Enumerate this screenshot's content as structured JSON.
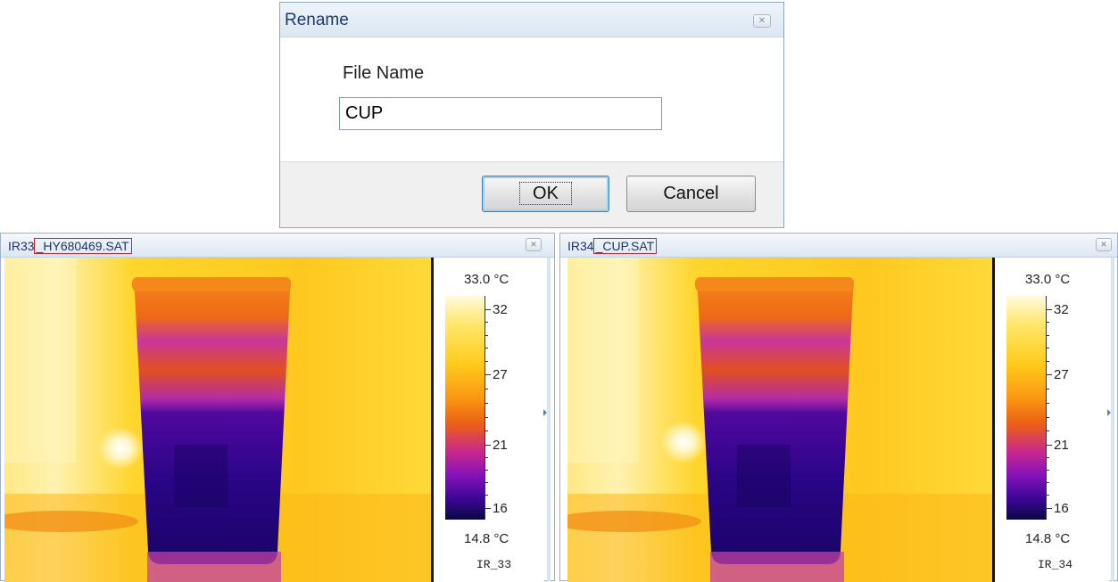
{
  "dialog": {
    "title": "Rename",
    "close_icon": "close-icon",
    "field_label": "File Name",
    "field_value": "CUP",
    "ok_label": "OK",
    "cancel_label": "Cancel"
  },
  "windows": [
    {
      "title_prefix": "IR33",
      "title_highlight": "_HY680469.SAT",
      "scale_max": "33.0 °C",
      "scale_min": "14.8 °C",
      "ticks": [
        "32",
        "27",
        "21",
        "16"
      ],
      "scale_id": "IR_33"
    },
    {
      "title_prefix": "IR34",
      "title_highlight": "_CUP.SAT",
      "scale_max": "33.0 °C",
      "scale_min": "14.8 °C",
      "ticks": [
        "32",
        "27",
        "21",
        "16"
      ],
      "scale_id": "IR_34"
    }
  ],
  "palette": {
    "hot": "#fffbe0",
    "warm": "#ffcc1c",
    "mid": "#ec6014",
    "cool": "#8713b9",
    "cold": "#080742",
    "highlight_border": "#d0212a"
  }
}
